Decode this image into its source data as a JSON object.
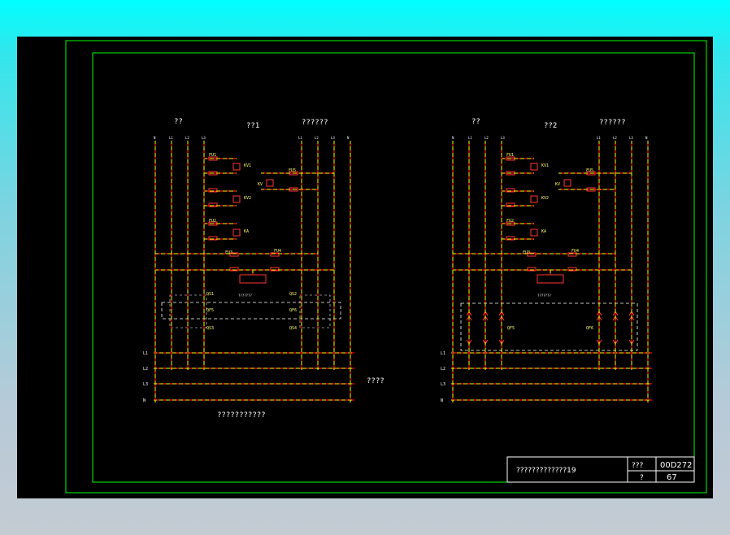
{
  "colors": {
    "sheet_background": "#000000",
    "frame": "#00ff00",
    "wire": "#ffff00",
    "wire_dash": "#ff0000",
    "component": "#ff3333",
    "text": "#ffffff",
    "device_text": "#ffff66"
  },
  "left_panel": {
    "title": "??1",
    "source_label": "??",
    "load_label": "??????",
    "bus_top_left": [
      "N",
      "L1",
      "L2",
      "L3"
    ],
    "bus_top_right": [
      "L1",
      "L2",
      "L3",
      "N"
    ],
    "bottom_bus": [
      "L1",
      "L2",
      "L3",
      "N"
    ],
    "fuses": [
      "FU1",
      "FU2",
      "FU3",
      "FU4",
      "FU5"
    ],
    "relays": [
      "KV1",
      "KV2",
      "KA",
      "KV"
    ],
    "module_label": "???????",
    "switches": [
      "QS1",
      "QF5",
      "QS2",
      "QS3",
      "QF6",
      "QS4"
    ],
    "caption": "???????????"
  },
  "right_panel": {
    "title": "??2",
    "source_label": "??",
    "load_label": "??????",
    "bus_top_left": [
      "N",
      "L1",
      "L2",
      "L3"
    ],
    "bus_top_right": [
      "L1",
      "L2",
      "L3",
      "N"
    ],
    "bottom_bus": [
      "L1",
      "L2",
      "L3",
      "N"
    ],
    "fuses": [
      "FU1",
      "FU2",
      "FU3",
      "FU4",
      "FU5"
    ],
    "relays": [
      "KV1",
      "KV2",
      "KA",
      "KV"
    ],
    "module_label": "???????",
    "switches": [
      "QF5",
      "QF6"
    ]
  },
  "side_note": "????",
  "title_block": {
    "name": "?????????????19",
    "field_label_1": "???",
    "field_value_1": "00D272",
    "field_label_2": "?",
    "field_value_2": "67"
  }
}
